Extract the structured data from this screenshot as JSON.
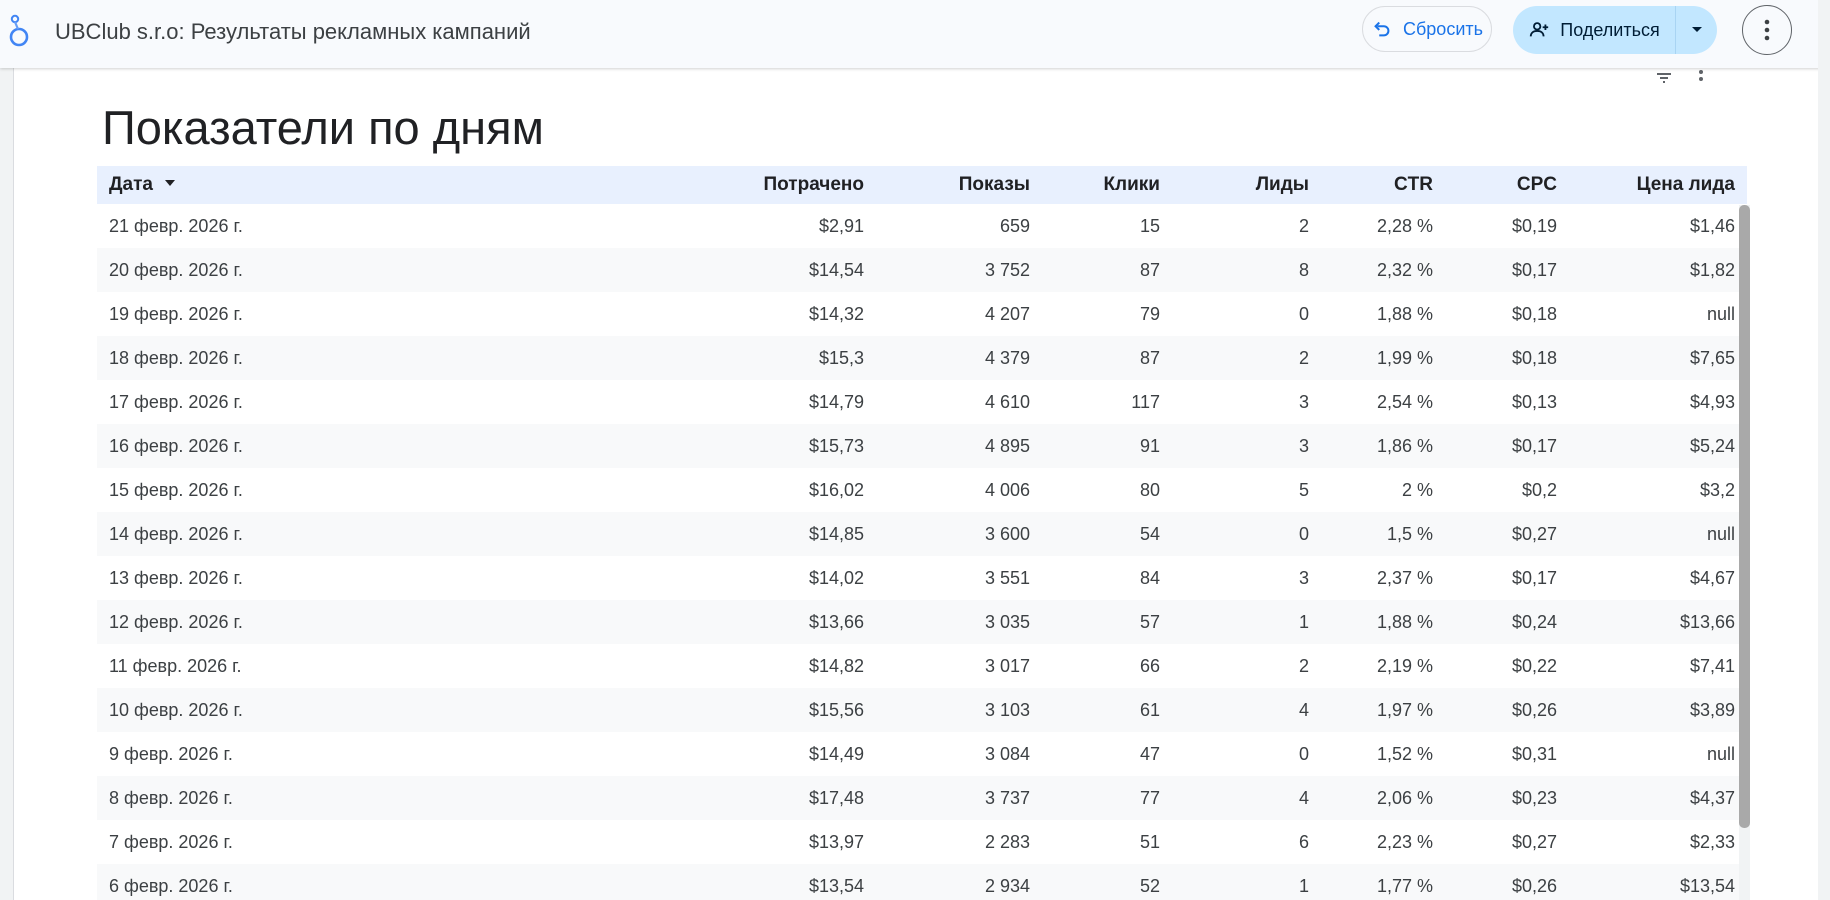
{
  "header": {
    "title": "UBClub s.r.o: Результаты рекламных кампаний",
    "reset_label": "Сбросить",
    "share_label": "Поделиться"
  },
  "report": {
    "title": "Показатели по дням"
  },
  "table": {
    "columns": [
      "Дата",
      "Потрачено",
      "Показы",
      "Клики",
      "Лиды",
      "CTR",
      "CPC",
      "Цена лида"
    ],
    "sort_column": "Дата",
    "sort_direction": "descending",
    "rows": [
      [
        "21 февр. 2026 г.",
        "$2,91",
        "659",
        "15",
        "2",
        "2,28 %",
        "$0,19",
        "$1,46"
      ],
      [
        "20 февр. 2026 г.",
        "$14,54",
        "3 752",
        "87",
        "8",
        "2,32 %",
        "$0,17",
        "$1,82"
      ],
      [
        "19 февр. 2026 г.",
        "$14,32",
        "4 207",
        "79",
        "0",
        "1,88 %",
        "$0,18",
        "null"
      ],
      [
        "18 февр. 2026 г.",
        "$15,3",
        "4 379",
        "87",
        "2",
        "1,99 %",
        "$0,18",
        "$7,65"
      ],
      [
        "17 февр. 2026 г.",
        "$14,79",
        "4 610",
        "117",
        "3",
        "2,54 %",
        "$0,13",
        "$4,93"
      ],
      [
        "16 февр. 2026 г.",
        "$15,73",
        "4 895",
        "91",
        "3",
        "1,86 %",
        "$0,17",
        "$5,24"
      ],
      [
        "15 февр. 2026 г.",
        "$16,02",
        "4 006",
        "80",
        "5",
        "2 %",
        "$0,2",
        "$3,2"
      ],
      [
        "14 февр. 2026 г.",
        "$14,85",
        "3 600",
        "54",
        "0",
        "1,5 %",
        "$0,27",
        "null"
      ],
      [
        "13 февр. 2026 г.",
        "$14,02",
        "3 551",
        "84",
        "3",
        "2,37 %",
        "$0,17",
        "$4,67"
      ],
      [
        "12 февр. 2026 г.",
        "$13,66",
        "3 035",
        "57",
        "1",
        "1,88 %",
        "$0,24",
        "$13,66"
      ],
      [
        "11 февр. 2026 г.",
        "$14,82",
        "3 017",
        "66",
        "2",
        "2,19 %",
        "$0,22",
        "$7,41"
      ],
      [
        "10 февр. 2026 г.",
        "$15,56",
        "3 103",
        "61",
        "4",
        "1,97 %",
        "$0,26",
        "$3,89"
      ],
      [
        "9 февр. 2026 г.",
        "$14,49",
        "3 084",
        "47",
        "0",
        "1,52 %",
        "$0,31",
        "null"
      ],
      [
        "8 февр. 2026 г.",
        "$17,48",
        "3 737",
        "77",
        "4",
        "2,06 %",
        "$0,23",
        "$4,37"
      ],
      [
        "7 февр. 2026 г.",
        "$13,97",
        "2 283",
        "51",
        "6",
        "2,23 %",
        "$0,27",
        "$2,33"
      ],
      [
        "6 февр. 2026 г.",
        "$13,54",
        "2 934",
        "52",
        "1",
        "1,77 %",
        "$0,26",
        "$13,54"
      ]
    ]
  },
  "icons": {
    "logo": "looker-studio-logo-icon",
    "reset": "undo-icon",
    "share": "person-add-icon",
    "share_dropdown": "caret-down-icon",
    "more": "more-vert-icon",
    "widget_filter": "filter-icon",
    "widget_more": "more-vert-icon"
  },
  "colors": {
    "accent": "#1a73e8",
    "share_bg": "#c2e7ff",
    "header_row_bg": "#e8f0fe",
    "stripe_bg": "#f8f9fa"
  }
}
